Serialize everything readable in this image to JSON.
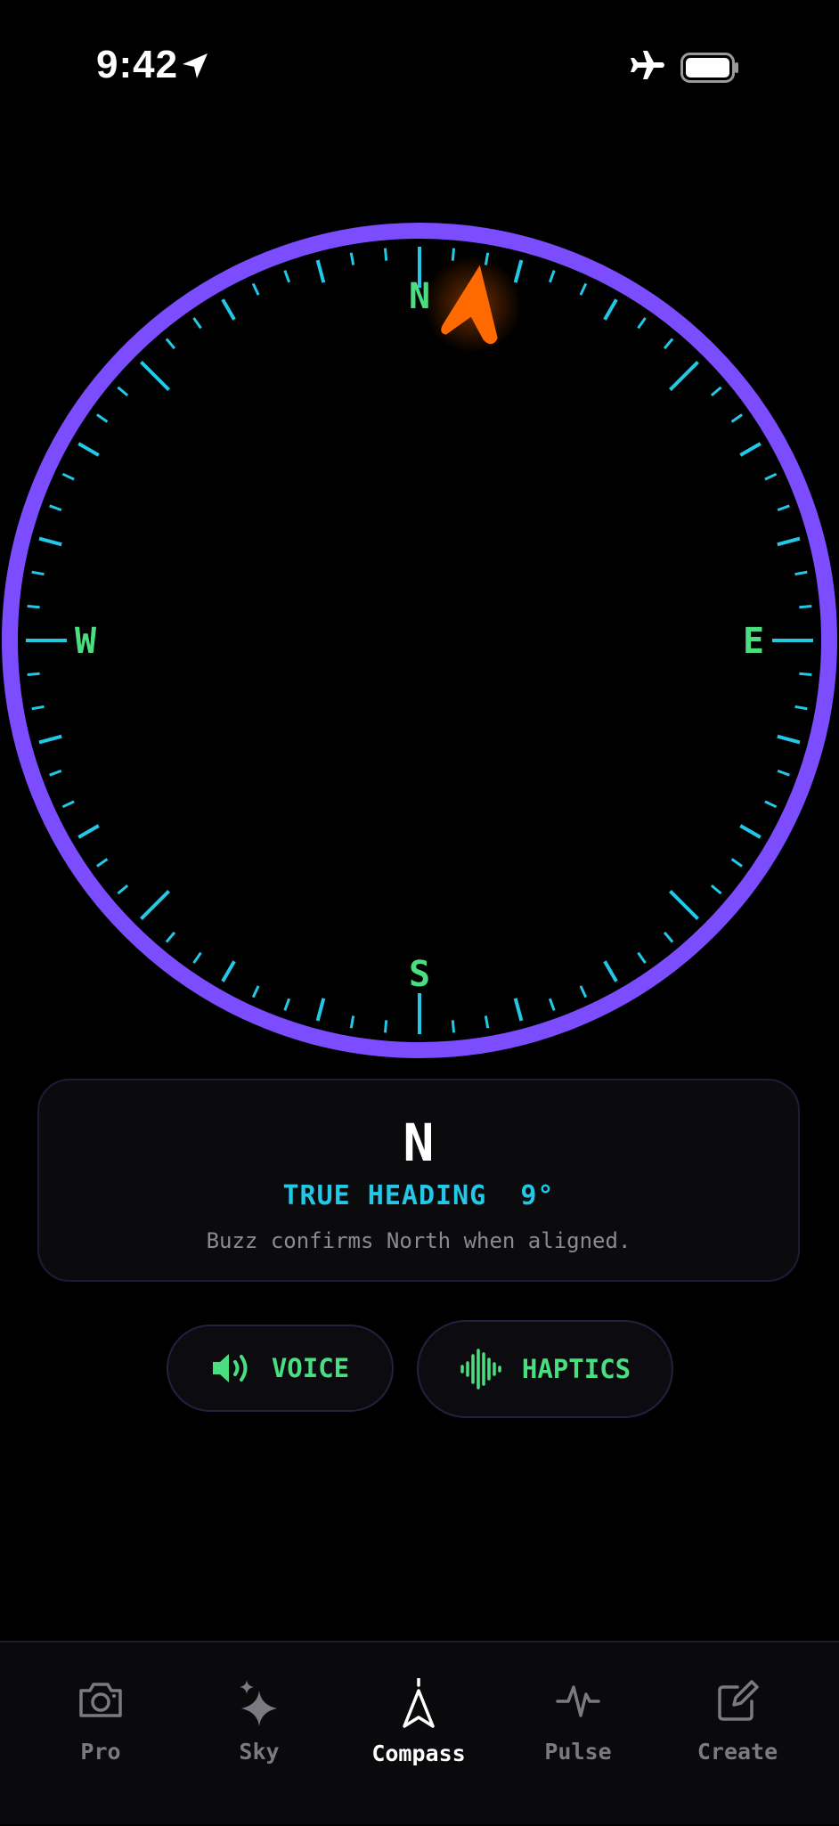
{
  "status_bar": {
    "time": "9:42",
    "icons": [
      "location-arrow-icon",
      "airplane-icon",
      "battery-icon"
    ]
  },
  "compass": {
    "cardinals": {
      "north": "N",
      "east": "E",
      "south": "S",
      "west": "W"
    },
    "heading_degrees": 9,
    "colors": {
      "ring": "#7c4dff",
      "ticks": "#22c8e6",
      "cardinal": "#4ade80",
      "pointer": "#ff6a00"
    }
  },
  "heading_card": {
    "direction": "N",
    "heading_text": "TRUE HEADING  9°",
    "note": "Buzz confirms North when aligned."
  },
  "controls": {
    "voice_label": "VOICE",
    "haptics_label": "HAPTICS"
  },
  "tabbar": {
    "tabs": [
      {
        "label": "Pro",
        "icon": "camera-icon"
      },
      {
        "label": "Sky",
        "icon": "sparkles-icon"
      },
      {
        "label": "Compass",
        "icon": "compass-needle-icon",
        "active": true
      },
      {
        "label": "Pulse",
        "icon": "pulse-icon"
      },
      {
        "label": "Create",
        "icon": "edit-icon"
      }
    ]
  }
}
